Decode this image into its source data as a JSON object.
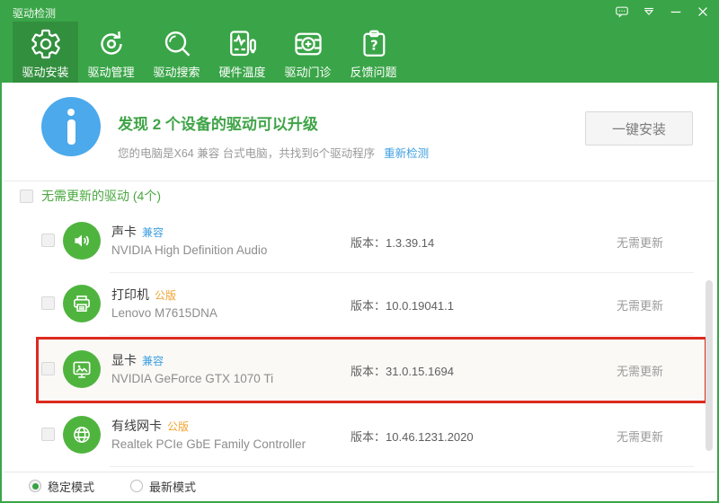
{
  "window": {
    "title": "驱动检测"
  },
  "titlebar": {
    "icons": [
      "message-icon",
      "theme-icon",
      "minimize-icon",
      "close-icon"
    ]
  },
  "toolbar": {
    "tabs": [
      {
        "label": "驱动安装",
        "icon": "gear-icon",
        "active": true
      },
      {
        "label": "驱动管理",
        "icon": "refresh-icon",
        "active": false
      },
      {
        "label": "驱动搜索",
        "icon": "search-icon",
        "active": false
      },
      {
        "label": "硬件温度",
        "icon": "temperature-icon",
        "active": false
      },
      {
        "label": "驱动门诊",
        "icon": "clinic-icon",
        "active": false
      },
      {
        "label": "反馈问题",
        "icon": "feedback-icon",
        "active": false
      }
    ]
  },
  "summary": {
    "title": "发现 2 个设备的驱动可以升级",
    "subtitle": "您的电脑是X64 兼容 台式电脑，共找到6个驱动程序",
    "recheck_link": "重新检测",
    "install_button": "一键安装"
  },
  "labels": {
    "version": "版本："
  },
  "section": {
    "title": "无需更新的驱动 (4个)"
  },
  "drivers": [
    {
      "name": "声卡",
      "badge": "兼容",
      "badge_type": "blue",
      "model": "NVIDIA High Definition Audio",
      "version": "1.3.39.14",
      "status": "无需更新",
      "icon": "speaker-icon",
      "highlighted": false
    },
    {
      "name": "打印机",
      "badge": "公版",
      "badge_type": "orange",
      "model": "Lenovo M7615DNA",
      "version": "10.0.19041.1",
      "status": "无需更新",
      "icon": "printer-icon",
      "highlighted": false
    },
    {
      "name": "显卡",
      "badge": "兼容",
      "badge_type": "blue",
      "model": "NVIDIA GeForce GTX 1070 Ti",
      "version": "31.0.15.1694",
      "status": "无需更新",
      "icon": "display-icon",
      "highlighted": true
    },
    {
      "name": "有线网卡",
      "badge": "公版",
      "badge_type": "orange",
      "model": "Realtek PCIe GbE Family Controller",
      "version": "10.46.1231.2020",
      "status": "无需更新",
      "icon": "globe-icon",
      "highlighted": false
    }
  ],
  "footer": {
    "modes": [
      {
        "label": "稳定模式",
        "selected": true
      },
      {
        "label": "最新模式",
        "selected": false
      }
    ]
  },
  "colors": {
    "accent_green": "#3aa548",
    "device_icon_green": "#4fb43e",
    "info_blue": "#4ba9ec",
    "link_blue": "#3d9fe0",
    "badge_orange": "#f1a431",
    "highlight_red": "#dd2a1f"
  }
}
